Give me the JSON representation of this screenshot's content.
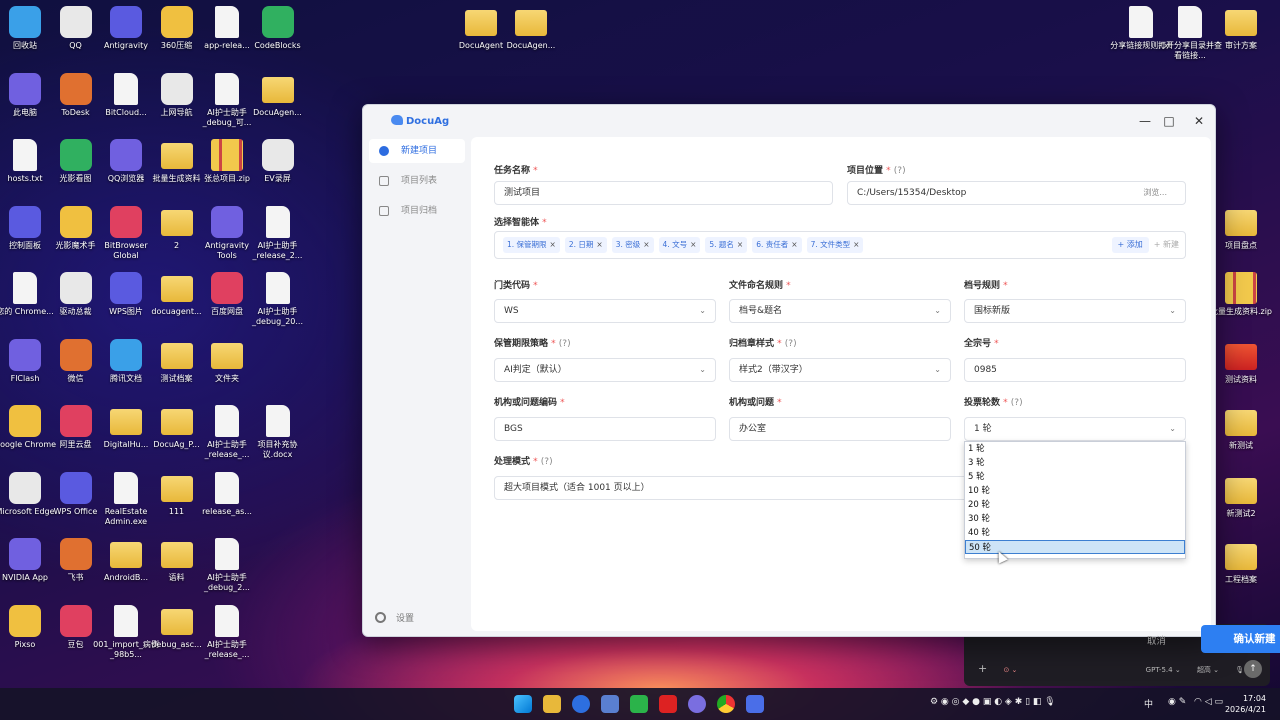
{
  "desktop": {
    "icons": [
      {
        "label": "回收站",
        "x": 0,
        "y": 0
      },
      {
        "label": "QQ",
        "x": 1,
        "y": 0
      },
      {
        "label": "Antigravity",
        "x": 2,
        "y": 0
      },
      {
        "label": "360压缩",
        "x": 3,
        "y": 0
      },
      {
        "label": "app-relea...",
        "x": 4,
        "y": 0
      },
      {
        "label": "CodeBlocks",
        "x": 5,
        "y": 0
      },
      {
        "label": "此电脑",
        "x": 0,
        "y": 1
      },
      {
        "label": "ToDesk",
        "x": 1,
        "y": 1
      },
      {
        "label": "BitCloud...",
        "x": 2,
        "y": 1
      },
      {
        "label": "上网导航",
        "x": 3,
        "y": 1
      },
      {
        "label": "AI护士助手_debug_可...",
        "x": 4,
        "y": 1
      },
      {
        "label": "DocuAgen...",
        "x": 5,
        "y": 1
      },
      {
        "label": "hosts.txt",
        "x": 0,
        "y": 2
      },
      {
        "label": "光影看图",
        "x": 1,
        "y": 2
      },
      {
        "label": "QQ浏览器",
        "x": 2,
        "y": 2
      },
      {
        "label": "批量生成资料",
        "x": 3,
        "y": 2
      },
      {
        "label": "张总项目.zip",
        "x": 4,
        "y": 2
      },
      {
        "label": "EV录屏",
        "x": 5,
        "y": 2
      },
      {
        "label": "控制面板",
        "x": 0,
        "y": 3
      },
      {
        "label": "光影魔术手",
        "x": 1,
        "y": 3
      },
      {
        "label": "BitBrowser Global",
        "x": 2,
        "y": 3
      },
      {
        "label": "2",
        "x": 3,
        "y": 3
      },
      {
        "label": "Antigravity Tools",
        "x": 4,
        "y": 3
      },
      {
        "label": "AI护士助手_release_2...",
        "x": 5,
        "y": 3
      },
      {
        "label": "您的 Chrome...",
        "x": 0,
        "y": 4
      },
      {
        "label": "驱动总裁",
        "x": 1,
        "y": 4
      },
      {
        "label": "WPS图片",
        "x": 2,
        "y": 4
      },
      {
        "label": "docuagent...",
        "x": 3,
        "y": 4
      },
      {
        "label": "百度网盘",
        "x": 4,
        "y": 4
      },
      {
        "label": "AI护士助手_debug_20...",
        "x": 5,
        "y": 4
      },
      {
        "label": "FlClash",
        "x": 0,
        "y": 5
      },
      {
        "label": "微信",
        "x": 1,
        "y": 5
      },
      {
        "label": "腾讯文档",
        "x": 2,
        "y": 5
      },
      {
        "label": "测试档案",
        "x": 3,
        "y": 5
      },
      {
        "label": "文件夹",
        "x": 4,
        "y": 5
      },
      {
        "label": "Google Chrome",
        "x": 0,
        "y": 6
      },
      {
        "label": "阿里云盘",
        "x": 1,
        "y": 6
      },
      {
        "label": "DigitalHu...",
        "x": 2,
        "y": 6
      },
      {
        "label": "DocuAg_P...",
        "x": 3,
        "y": 6
      },
      {
        "label": "AI护士助手_release_...",
        "x": 4,
        "y": 6
      },
      {
        "label": "项目补充协议.docx",
        "x": 5,
        "y": 6
      },
      {
        "label": "Microsoft Edge",
        "x": 0,
        "y": 7
      },
      {
        "label": "WPS Office",
        "x": 1,
        "y": 7
      },
      {
        "label": "RealEstate Admin.exe",
        "x": 2,
        "y": 7
      },
      {
        "label": "111",
        "x": 3,
        "y": 7
      },
      {
        "label": "release_as...",
        "x": 4,
        "y": 7
      },
      {
        "label": "NVIDIA App",
        "x": 0,
        "y": 8
      },
      {
        "label": "飞书",
        "x": 1,
        "y": 8
      },
      {
        "label": "AndroidB...",
        "x": 2,
        "y": 8
      },
      {
        "label": "语料",
        "x": 3,
        "y": 8
      },
      {
        "label": "AI护士助手_debug_2...",
        "x": 4,
        "y": 8
      },
      {
        "label": "Pixso",
        "x": 0,
        "y": 9
      },
      {
        "label": "豆包",
        "x": 1,
        "y": 9
      },
      {
        "label": "001_import_病例_98b5...",
        "x": 2,
        "y": 9
      },
      {
        "label": "debug_asc...",
        "x": 3,
        "y": 9
      },
      {
        "label": "AI护士助手_release_...",
        "x": 4,
        "y": 9
      }
    ],
    "top_icons": [
      "DocuAgent",
      "DocuAgen..."
    ],
    "right_icons": [
      "分享链接规则.txt",
      "打开分享目录并查看链接...",
      "审计方案",
      "项目盘点",
      "批量生成资料.zip",
      "测试资料",
      "新测试",
      "新测试2",
      "工程档案"
    ]
  },
  "app": {
    "title": "DocuAg",
    "window_controls": {
      "minimize": "—",
      "maximize": "□",
      "close": "✕"
    },
    "sidebar": {
      "items": [
        {
          "label": "新建项目",
          "icon": "robot-icon",
          "active": true
        },
        {
          "label": "项目列表",
          "icon": "list-icon",
          "active": false
        },
        {
          "label": "项目归档",
          "icon": "archive-icon",
          "active": false
        }
      ],
      "settings": "设置"
    },
    "form": {
      "task_name": {
        "label": "任务名称",
        "value": "测试项目"
      },
      "project_location": {
        "label": "项目位置",
        "value": "C:/Users/15354/Desktop",
        "browse": "浏览..."
      },
      "agents": {
        "label": "选择智能体",
        "tags": [
          "1. 保管期限",
          "2. 日期",
          "3. 密级",
          "4. 文号",
          "5. 题名",
          "6. 责任者",
          "7. 文件类型"
        ],
        "add": "+ 添加",
        "new": "+ 新建"
      },
      "category_code": {
        "label": "门类代码",
        "value": "WS"
      },
      "file_naming": {
        "label": "文件命名规则",
        "value": "档号&题名"
      },
      "archive_rule": {
        "label": "档号规则",
        "value": "国标新版"
      },
      "retention_strategy": {
        "label": "保管期限策略",
        "value": "AI判定（默认）"
      },
      "seal_style": {
        "label": "归档章样式",
        "value": "样式2（带汉字）"
      },
      "fonds_no": {
        "label": "全宗号",
        "value": "0985"
      },
      "org_code": {
        "label": "机构或问题编码",
        "value": "BGS"
      },
      "org_name": {
        "label": "机构或问题",
        "value": "办公室"
      },
      "vote_rounds": {
        "label": "投票轮数",
        "value": "1 轮",
        "options": [
          "1 轮",
          "3 轮",
          "5 轮",
          "10 轮",
          "20 轮",
          "30 轮",
          "40 轮",
          "50 轮"
        ],
        "highlighted": "50 轮"
      },
      "processing_mode": {
        "label": "处理模式",
        "value": "超大项目模式（适合 1001 页以上）"
      }
    },
    "required_mark": "*",
    "help_mark": "(?)",
    "cancel": "取消",
    "confirm": "确认新建"
  },
  "chat": {
    "model": "GPT-5.4",
    "effort": "超高"
  },
  "taskbar": {
    "ime": "中",
    "time": "17:04",
    "date": "2026/4/21"
  },
  "colors": {
    "primary": "#2d7ff2",
    "tag_bg": "#eef3ff",
    "tag_text": "#3a6fd6"
  }
}
